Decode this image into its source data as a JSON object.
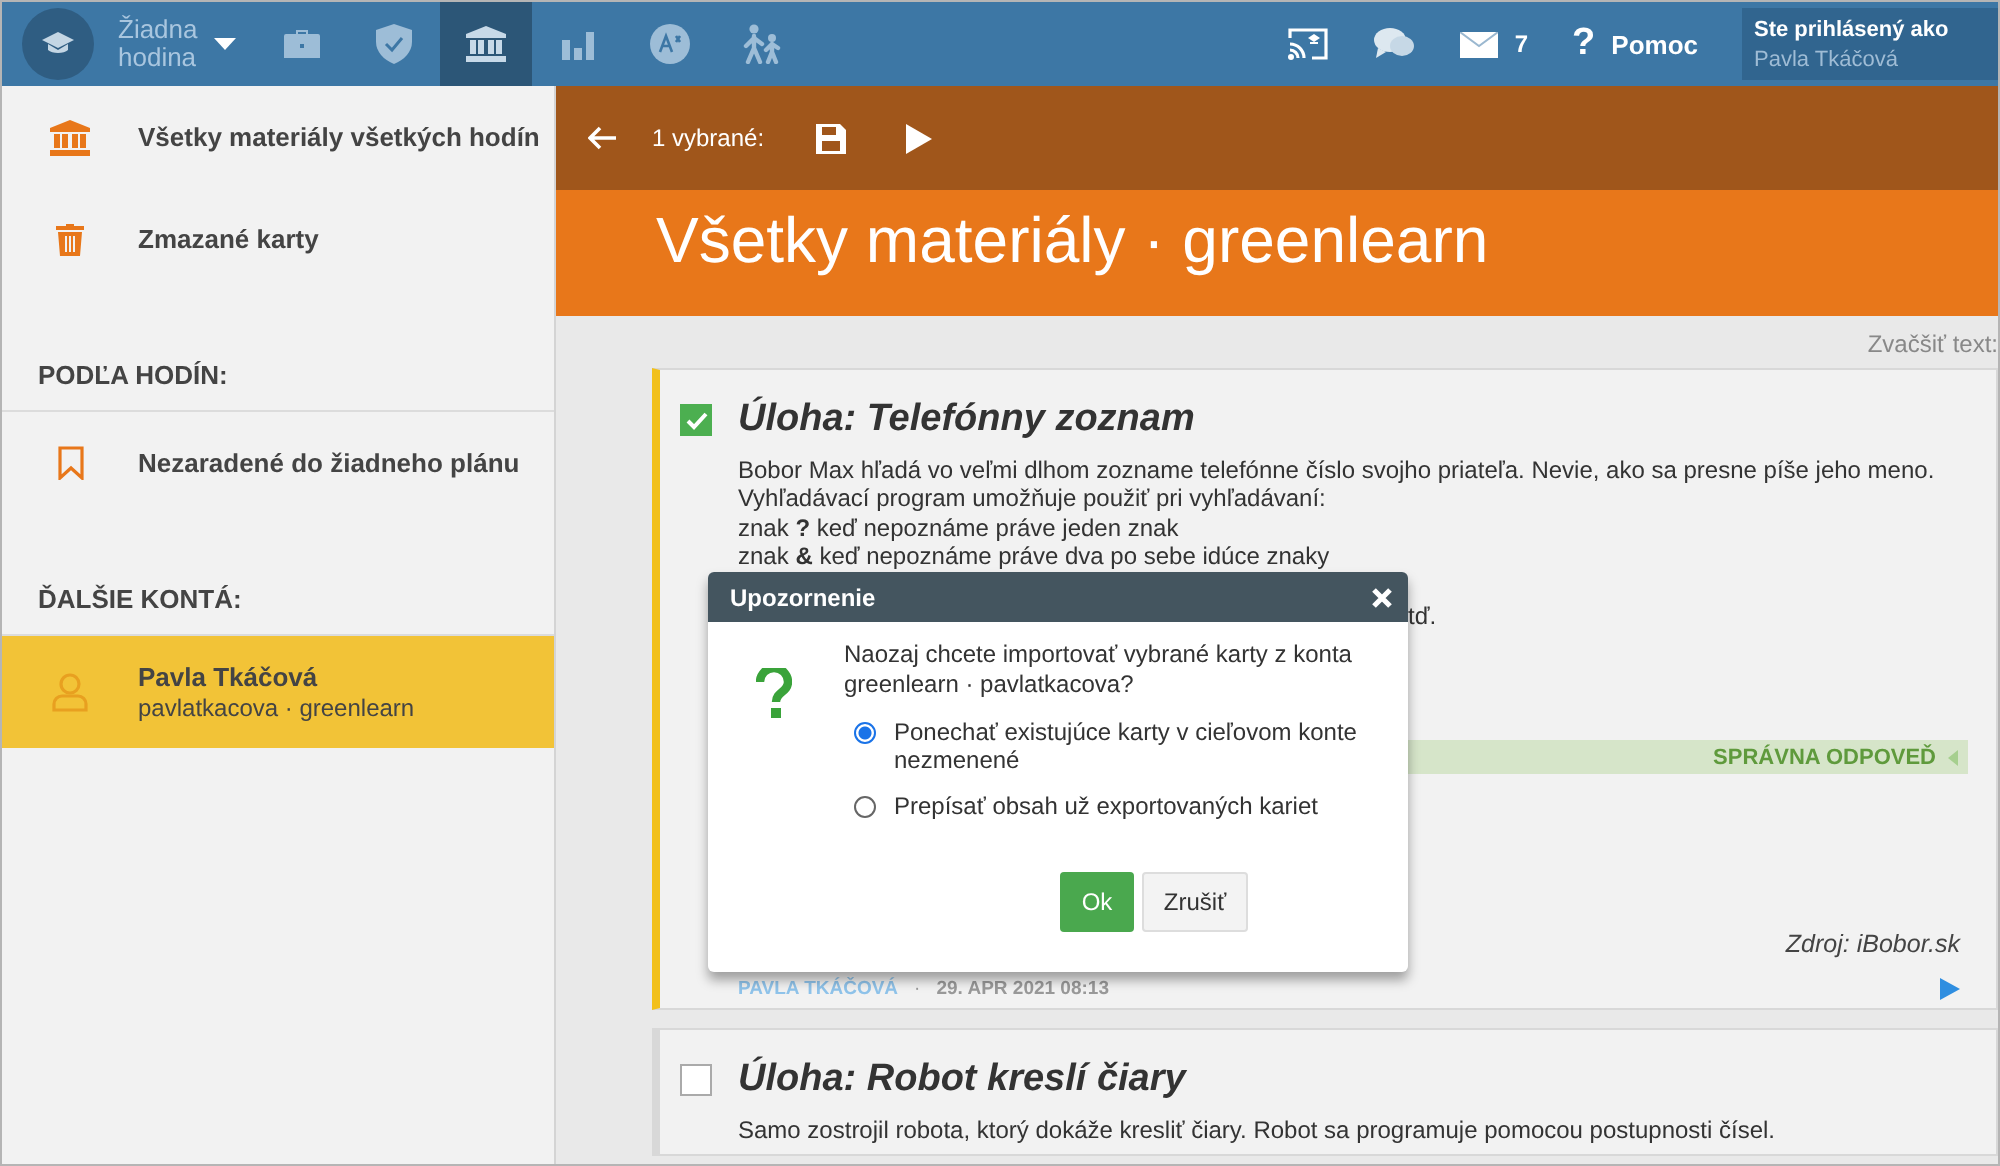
{
  "top_bar": {
    "lesson_picker": {
      "label": "Žiadna hodina"
    },
    "nav": [
      {
        "kind": "briefcase",
        "selected": false
      },
      {
        "kind": "shield",
        "selected": false
      },
      {
        "kind": "bank",
        "selected": true
      },
      {
        "kind": "chart",
        "selected": false
      },
      {
        "kind": "badge",
        "selected": false
      },
      {
        "kind": "hikers",
        "selected": false
      }
    ],
    "tools": [
      {
        "kind": "cast"
      },
      {
        "kind": "chat"
      },
      {
        "kind": "mail",
        "count": "7"
      },
      {
        "kind": "help",
        "glyph": "?",
        "label": "Pomoc"
      }
    ],
    "user": {
      "caption": "Ste prihlásený ako",
      "name": "Pavla Tkáčová"
    }
  },
  "sidebar": {
    "items": [
      {
        "kind": "bank",
        "label": "Všetky materiály všetkých hodín",
        "selected": false
      },
      {
        "kind": "trash",
        "label": "Zmazané karty",
        "selected": false
      },
      {
        "kind": "heading",
        "label": "PODĽA HODÍN:"
      },
      {
        "kind": "bookmark",
        "label": "Nezaradené do žiadneho plánu",
        "selected": false
      },
      {
        "kind": "heading",
        "label": "ĎALŠIE KONTÁ:"
      },
      {
        "kind": "account",
        "label": "Pavla Tkáčová",
        "sub": "pavlatkacova · greenlearn",
        "selected": true
      }
    ]
  },
  "toolbar": {
    "selection": "1 vybrané:"
  },
  "header": {
    "title": "Všetky materiály · greenlearn"
  },
  "zoom_label": "Zvačšiť text:",
  "cards": [
    {
      "checked": true,
      "title": "Úloha: Telefónny zoznam",
      "lines": [
        "Bobor Max hľadá vo veľmi dlhom zozname telefónne číslo svojho priateľa. Nevie, ako sa presne píše jeho meno.",
        "Vyhľadávací program umožňuje použiť pri vyhľadávaní:",
        "znak **?** keď nepoznáme práve jeden znak",
        "znak **&** keď nepoznáme práve dva po sebe idúce znaky"
      ],
      "line_fragment": "tď.",
      "answer_label": "SPRÁVNA ODPOVEĎ",
      "source": "Zdroj: iBobor.sk",
      "author": "PAVLA TKÁČOVÁ",
      "separator": "·",
      "date": "29. APR 2021 08:13"
    },
    {
      "checked": false,
      "title": "Úloha: Robot kreslí čiary",
      "lines": [
        "Samo zostrojil robota, ktorý dokáže kresliť čiary. Robot sa programuje pomocou postupnosti čísel."
      ]
    }
  ],
  "dialog": {
    "title": "Upozornenie",
    "question": "Naozaj chcete importovať vybrané karty z konta greenlearn · pavlatkacova?",
    "options": [
      {
        "label": "Ponechať existujúce karty v cieľovom konte nezmenené",
        "selected": true
      },
      {
        "label": "Prepísať obsah už exportovaných kariet",
        "selected": false
      }
    ],
    "buttons": [
      {
        "kind": "primary",
        "label": "Ok"
      },
      {
        "kind": "secondary",
        "label": "Zrušiť"
      }
    ]
  }
}
